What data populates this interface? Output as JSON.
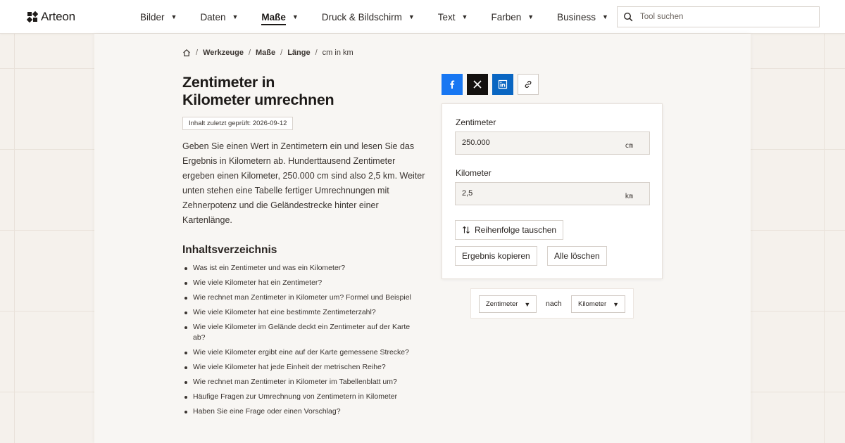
{
  "brand": {
    "name": "Arteon"
  },
  "nav": {
    "items": [
      {
        "label": "Bilder"
      },
      {
        "label": "Daten"
      },
      {
        "label": "Maße"
      },
      {
        "label": "Druck & Bildschirm"
      },
      {
        "label": "Text"
      },
      {
        "label": "Farben"
      },
      {
        "label": "Business"
      }
    ],
    "active_index": 2,
    "caret": "▼"
  },
  "search": {
    "placeholder": "Tool suchen",
    "value": ""
  },
  "breadcrumb": {
    "items": [
      "Werkzeuge",
      "Maße",
      "Länge",
      "cm in km"
    ],
    "separator": "/"
  },
  "page": {
    "title_line1": "Zentimeter in",
    "title_line2": "Kilometer umrechnen",
    "checked_badge": "Inhalt zuletzt geprüft: 2026-09-12",
    "intro": "Geben Sie einen Wert in Zentimetern ein und lesen Sie das Ergebnis in Kilometern ab. Hunderttausend Zentimeter ergeben einen Kilometer, 250.000 cm sind also 2,5 km. Weiter unten stehen eine Tabelle fertiger Umrechnungen mit Zehnerpotenz und die Geländestrecke hinter einer Kartenlänge."
  },
  "toc": {
    "title": "Inhaltsverzeichnis",
    "items": [
      "Was ist ein Zentimeter und was ein Kilometer?",
      "Wie viele Kilometer hat ein Zentimeter?",
      "Wie rechnet man Zentimeter in Kilometer um? Formel und Beispiel",
      "Wie viele Kilometer hat eine bestimmte Zentimeterzahl?",
      "Wie viele Kilometer im Gelände deckt ein Zentimeter auf der Karte ab?",
      "Wie viele Kilometer ergibt eine auf der Karte gemessene Strecke?",
      "Wie viele Kilometer hat jede Einheit der metrischen Reihe?",
      "Wie rechnet man Zentimeter in Kilometer im Tabellenblatt um?",
      "Häufige Fragen zur Umrechnung von Zentimetern in Kilometer",
      "Haben Sie eine Frage oder einen Vorschlag?"
    ]
  },
  "share": {
    "icons": [
      "facebook-icon",
      "x-icon",
      "linkedin-icon",
      "link-icon"
    ],
    "colors": {
      "facebook": "#1877f2",
      "x": "#14110f",
      "linkedin": "#0a66c2"
    }
  },
  "converter": {
    "from_label": "Zentimeter",
    "from_value": "250.000",
    "from_unit": "cm",
    "to_label": "Kilometer",
    "to_value": "2,5",
    "to_unit": "km",
    "swap_label": "Reihenfolge tauschen",
    "copy_label": "Ergebnis kopieren",
    "clear_label": "Alle löschen"
  },
  "unit_select": {
    "from": "Zentimeter",
    "connector": "nach",
    "to": "Kilometer"
  }
}
